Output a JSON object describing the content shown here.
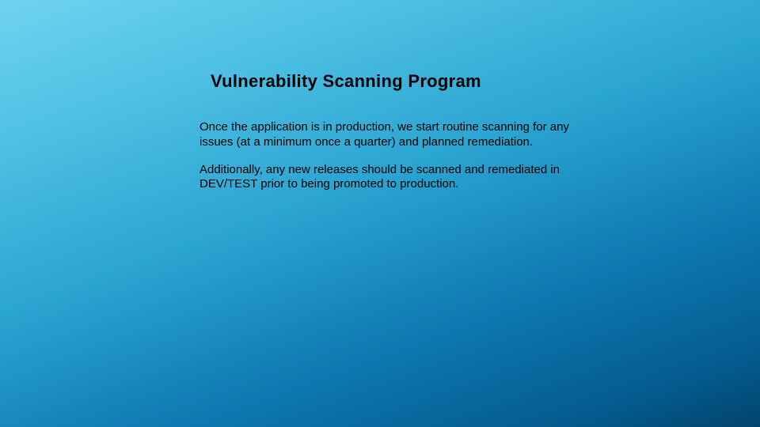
{
  "slide": {
    "title": "Vulnerability Scanning Program",
    "paragraph1": "Once the application is in production, we start routine scanning for any issues (at a minimum once a quarter) and planned remediation.",
    "paragraph2": "Additionally, any new releases should be scanned and remediated in DEV/TEST prior to being promoted to production."
  }
}
